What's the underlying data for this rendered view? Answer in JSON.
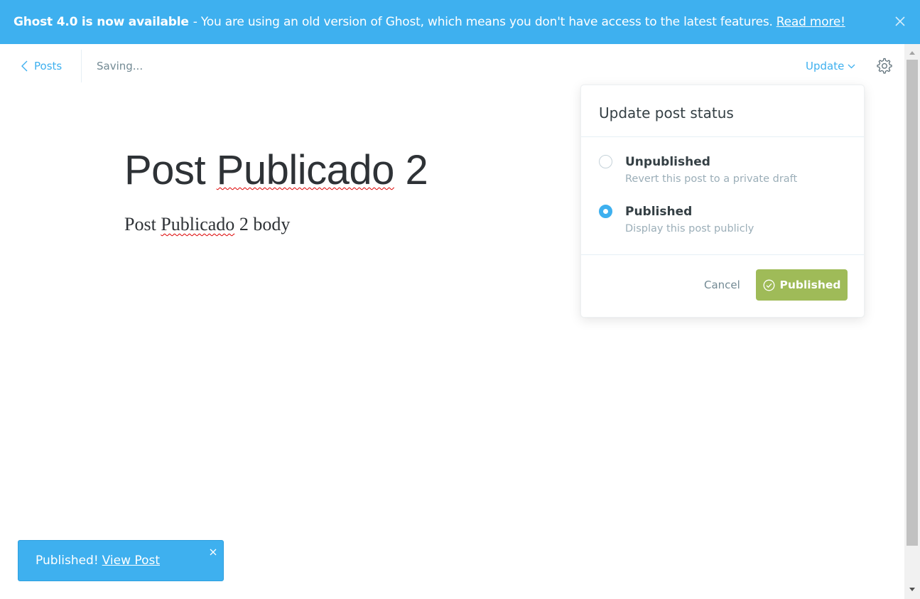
{
  "banner": {
    "headline": "Ghost 4.0 is now available",
    "message": "- You are using an old version of Ghost, which means you don't have access to the latest features.",
    "link": "Read more!",
    "background": "#3eb0ef"
  },
  "header": {
    "back_label": "Posts",
    "status": "Saving...",
    "update_label": "Update"
  },
  "post": {
    "title_parts": [
      "Post ",
      "Publicado",
      " 2"
    ],
    "body_parts": [
      "Post ",
      "Publicado",
      " 2 body"
    ]
  },
  "popover": {
    "title": "Update post status",
    "options": [
      {
        "label": "Unpublished",
        "description": "Revert this post to a private draft",
        "selected": false
      },
      {
        "label": "Published",
        "description": "Display this post publicly",
        "selected": true
      }
    ],
    "cancel_label": "Cancel",
    "confirm_label": "Published",
    "confirm_color": "#9fbb58"
  },
  "toast": {
    "message": "Published!",
    "link": "View Post"
  },
  "icons": {
    "banner_close": "close-icon",
    "back": "chevron-left-icon",
    "update_dropdown": "chevron-down-icon",
    "settings": "gear-icon",
    "confirm": "check-circle-icon",
    "toast_close": "close-icon"
  }
}
